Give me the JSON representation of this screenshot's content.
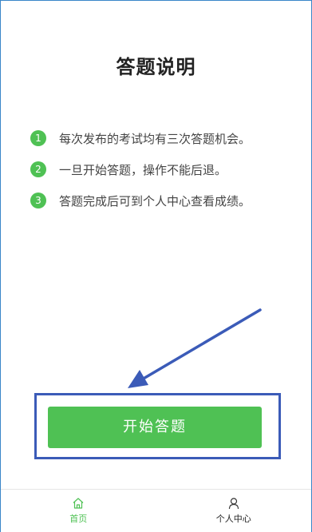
{
  "page": {
    "title": "答题说明"
  },
  "rules": [
    {
      "num": "1",
      "text": "每次发布的考试均有三次答题机会。"
    },
    {
      "num": "2",
      "text": "一旦开始答题，操作不能后退。"
    },
    {
      "num": "3",
      "text": "答题完成后可到个人中心查看成绩。"
    }
  ],
  "start_button": {
    "label": "开始答题"
  },
  "tabbar": {
    "tabs": [
      {
        "label": "首页",
        "icon": "home-icon",
        "active": true
      },
      {
        "label": "个人中心",
        "icon": "user-icon",
        "active": false
      }
    ]
  },
  "colors": {
    "accent": "#4fc154",
    "annotation": "#3b5bb8",
    "frame": "#3a86c9"
  }
}
